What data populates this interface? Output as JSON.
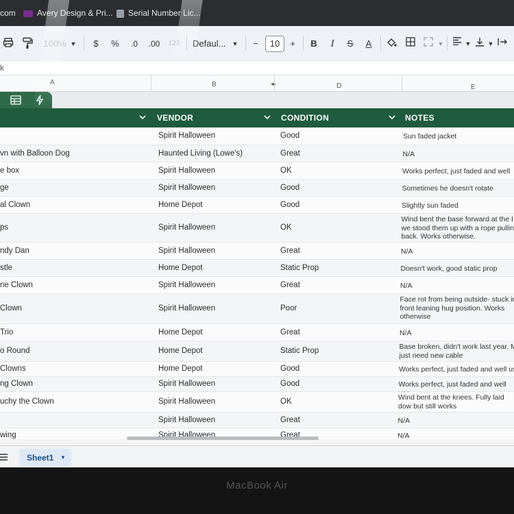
{
  "bookmarks": {
    "item1": "com",
    "item2": "Avery Design & Pri...",
    "item3": "Serial Number Lic..."
  },
  "toolbar": {
    "zoom": "100%",
    "currency": "$",
    "percent": "%",
    "dec_decrease": ".0",
    "dec_increase": ".00",
    "number_format": "123",
    "font": "Defaul...",
    "minus": "−",
    "font_size": "10",
    "plus": "+",
    "bold": "B",
    "italic": "I",
    "strike": "S",
    "text_color": "A"
  },
  "formula_bar": {
    "ref": "k"
  },
  "columns": {
    "a": "A",
    "b": "B",
    "d": "D",
    "e": "E"
  },
  "headers": {
    "vendor": "VENDOR",
    "condition": "CONDITION",
    "notes": "NOTES"
  },
  "rows": [
    {
      "name": "",
      "vendor": "Spirit Halloween",
      "condition": "Good",
      "notes": "Sun faded jacket"
    },
    {
      "name": "vn with Balloon Dog",
      "vendor": "Haunted Living (Lowe's)",
      "condition": "Great",
      "notes": "N/A"
    },
    {
      "name": "e box",
      "vendor": "Spirit Halloween",
      "condition": "OK",
      "notes": "Works perfect, just faded and well"
    },
    {
      "name": "ge",
      "vendor": "Spirit Halloween",
      "condition": "Good",
      "notes": "Sometimes he doesn't rotate"
    },
    {
      "name": "al Clown",
      "vendor": "Home Depot",
      "condition": "Good",
      "notes": "Slightly sun faded"
    },
    {
      "name": "ps",
      "vendor": "Spirit Halloween",
      "condition": "OK",
      "notes": "Wind bent the base forward at the I we stood them up with a rope pullin back. Works otherwise."
    },
    {
      "name": "ndy Dan",
      "vendor": "Spirit Halloween",
      "condition": "Great",
      "notes": "N/A"
    },
    {
      "name": "stle",
      "vendor": "Home Depot",
      "condition": "Static Prop",
      "notes": "Doesn't work, good static prop"
    },
    {
      "name": "ne Clown",
      "vendor": "Spirit Halloween",
      "condition": "Great",
      "notes": "N/A"
    },
    {
      "name": "Clown",
      "vendor": "Spirit Halloween",
      "condition": "Poor",
      "notes": "Face rot from being outside- stuck in front leaning hug position. Works otherwise"
    },
    {
      "name": "Trio",
      "vendor": "Home Depot",
      "condition": "Great",
      "notes": "N/A"
    },
    {
      "name": "o Round",
      "vendor": "Home Depot",
      "condition": "Static Prop",
      "notes": "Base broken, didn't work last year. Mi just need new cable"
    },
    {
      "name": "Clowns",
      "vendor": "Home Depot",
      "condition": "Good",
      "notes": "Works perfect, just faded and well us"
    },
    {
      "name": "ng Clown",
      "vendor": "Spirit Halloween",
      "condition": "Good",
      "notes": "Works perfect, just faded and well use"
    },
    {
      "name": "uchy the Clown",
      "vendor": "Spirit Halloween",
      "condition": "OK",
      "notes": "Wind bent at the knees. Fully laid dow but still works"
    },
    {
      "name": "",
      "vendor": "Spirit Halloween",
      "condition": "Great",
      "notes": "N/A"
    },
    {
      "name": "wing",
      "vendor": "Spirit Halloween",
      "condition": "Great",
      "notes": "N/A"
    }
  ],
  "sheet_tab": {
    "label": "Sheet1"
  },
  "laptop": {
    "label": "MacBook Air"
  },
  "colors": {
    "header_green": "#1e5b3f",
    "tab_green": "#2f6b4b"
  }
}
